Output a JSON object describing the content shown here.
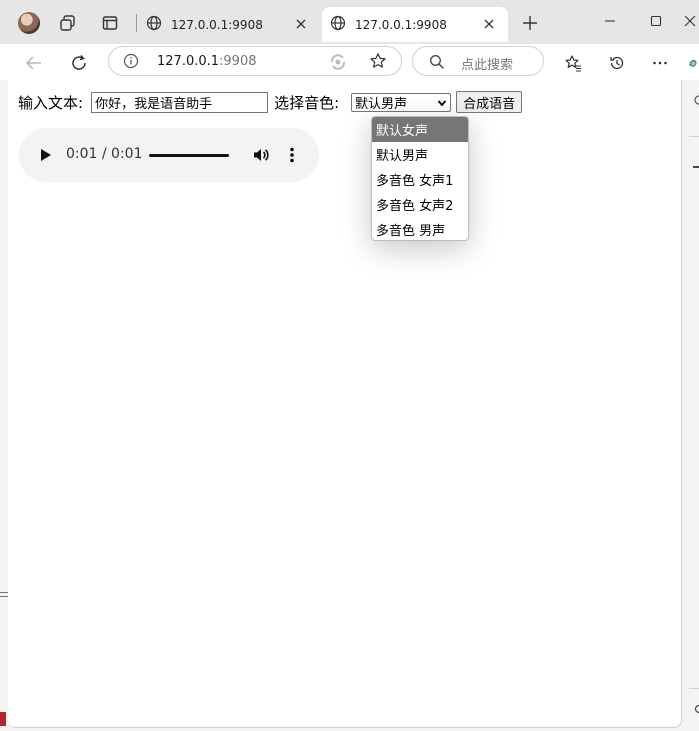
{
  "browser": {
    "tabs": [
      {
        "title": "127.0.0.1:9908",
        "active": false
      },
      {
        "title": "127.0.0.1:9908",
        "active": true
      }
    ],
    "address": {
      "host": "127.0.0.1",
      "port": ":9908"
    },
    "search_placeholder": "点此搜索"
  },
  "form": {
    "text_label": "输入文本:",
    "text_value": "你好，我是语音助手",
    "voice_label": "选择音色:",
    "voice_selected": "默认男声",
    "voice_options": [
      "默认女声",
      "默认男声",
      "多音色 女声1",
      "多音色 女声2",
      "多音色 男声"
    ],
    "highlighted_option": "默认女声",
    "synth_button": "合成语音"
  },
  "audio": {
    "time": "0:01 / 0:01",
    "progress": 1.0
  },
  "icons": {
    "play": "play-icon",
    "volume": "volume-icon",
    "more": "more-vertical-icon"
  }
}
